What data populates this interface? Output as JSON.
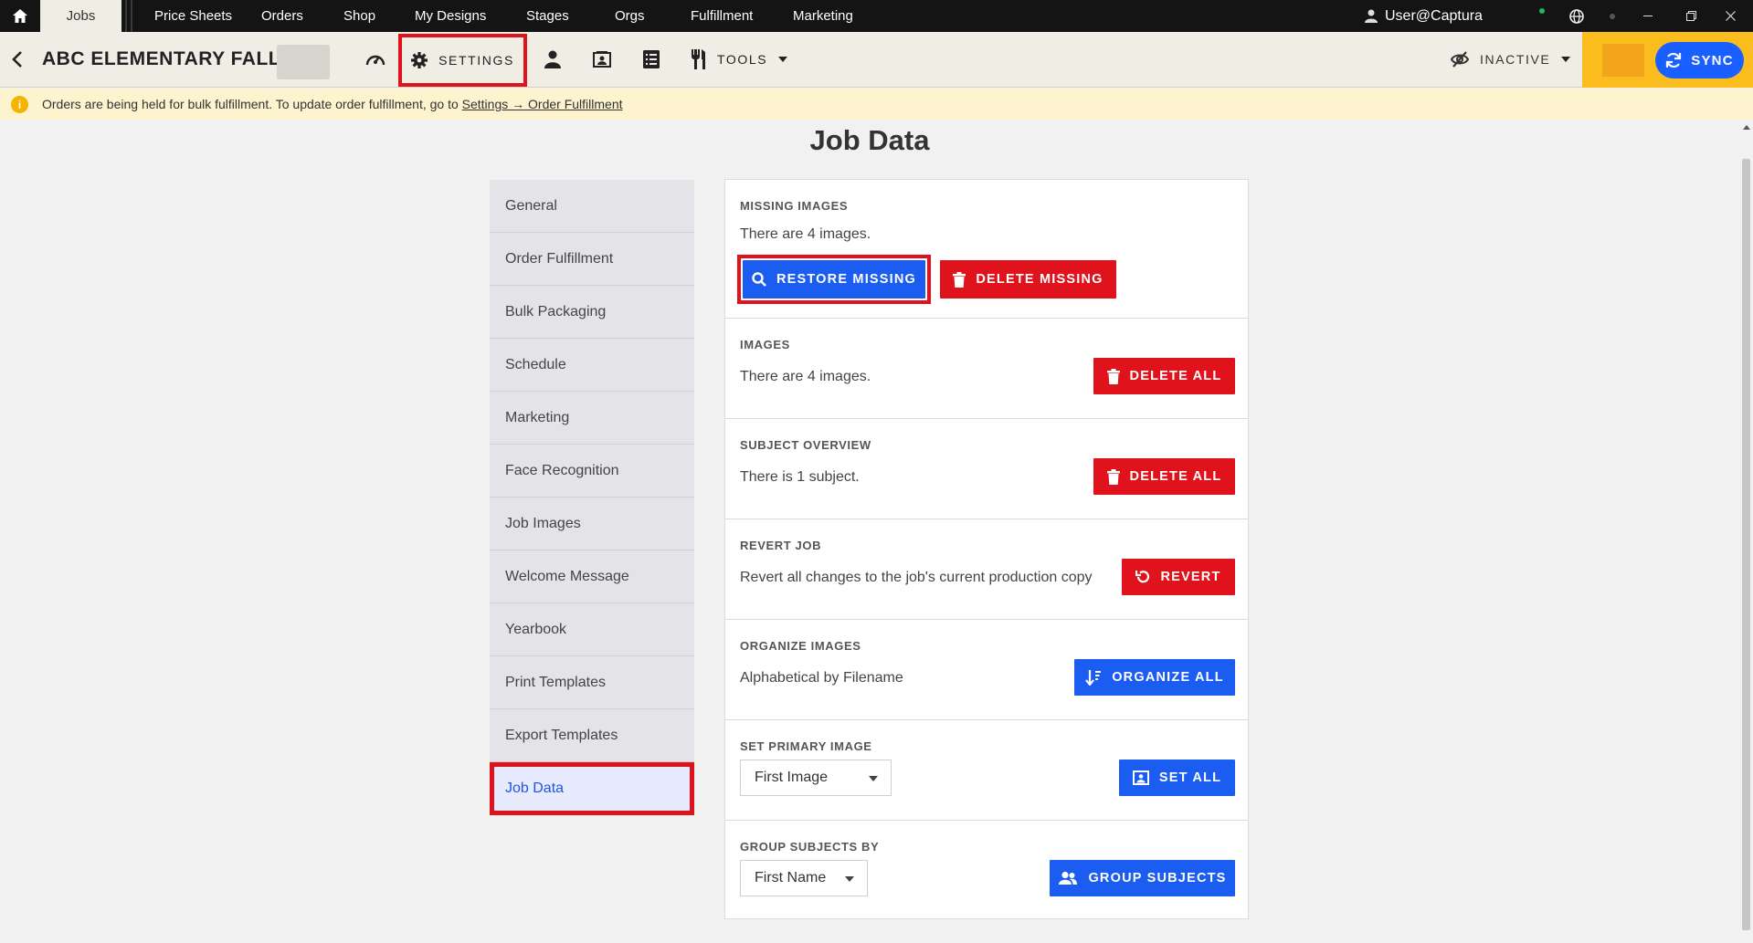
{
  "topnav": {
    "tabs": [
      "Jobs",
      "Price Sheets",
      "Orders",
      "Shop",
      "My Designs",
      "Stages",
      "Orgs",
      "Fulfillment",
      "Marketing"
    ],
    "user": "User@Captura"
  },
  "toolbar": {
    "job_title": "ABC ELEMENTARY FALL",
    "settings_label": "SETTINGS",
    "tools_label": "TOOLS",
    "status_label": "INACTIVE",
    "sync_label": "SYNC"
  },
  "banner": {
    "text": "Orders are being held for bulk fulfillment. To update order fulfillment, go to",
    "link": "Settings → Order Fulfillment"
  },
  "page": {
    "title": "Job Data"
  },
  "sidebar": {
    "items": [
      "General",
      "Order Fulfillment",
      "Bulk Packaging",
      "Schedule",
      "Marketing",
      "Face Recognition",
      "Job Images",
      "Welcome Message",
      "Yearbook",
      "Print Templates",
      "Export Templates",
      "Job Data"
    ],
    "active": "Job Data"
  },
  "sections": {
    "missing_images": {
      "heading": "MISSING IMAGES",
      "desc": "There are 4 images.",
      "restore_label": "RESTORE MISSING",
      "delete_label": "DELETE MISSING"
    },
    "images": {
      "heading": "IMAGES",
      "desc": "There are 4 images.",
      "button_label": "DELETE ALL"
    },
    "subject_overview": {
      "heading": "SUBJECT OVERVIEW",
      "desc": "There is 1 subject.",
      "button_label": "DELETE ALL"
    },
    "revert_job": {
      "heading": "REVERT JOB",
      "desc": "Revert all changes to the job's current production copy",
      "button_label": "REVERT"
    },
    "organize_images": {
      "heading": "ORGANIZE IMAGES",
      "desc": "Alphabetical by Filename",
      "button_label": "ORGANIZE ALL"
    },
    "set_primary_image": {
      "heading": "SET PRIMARY IMAGE",
      "select_value": "First Image",
      "button_label": "SET ALL"
    },
    "group_subjects_by": {
      "heading": "GROUP SUBJECTS BY",
      "select_value": "First Name",
      "button_label": "GROUP SUBJECTS"
    }
  },
  "colors": {
    "accent_blue": "#1c5df1",
    "danger_red": "#e0121c",
    "highlight": "#e0121c",
    "brand_yellow": "#fbbd1e"
  }
}
